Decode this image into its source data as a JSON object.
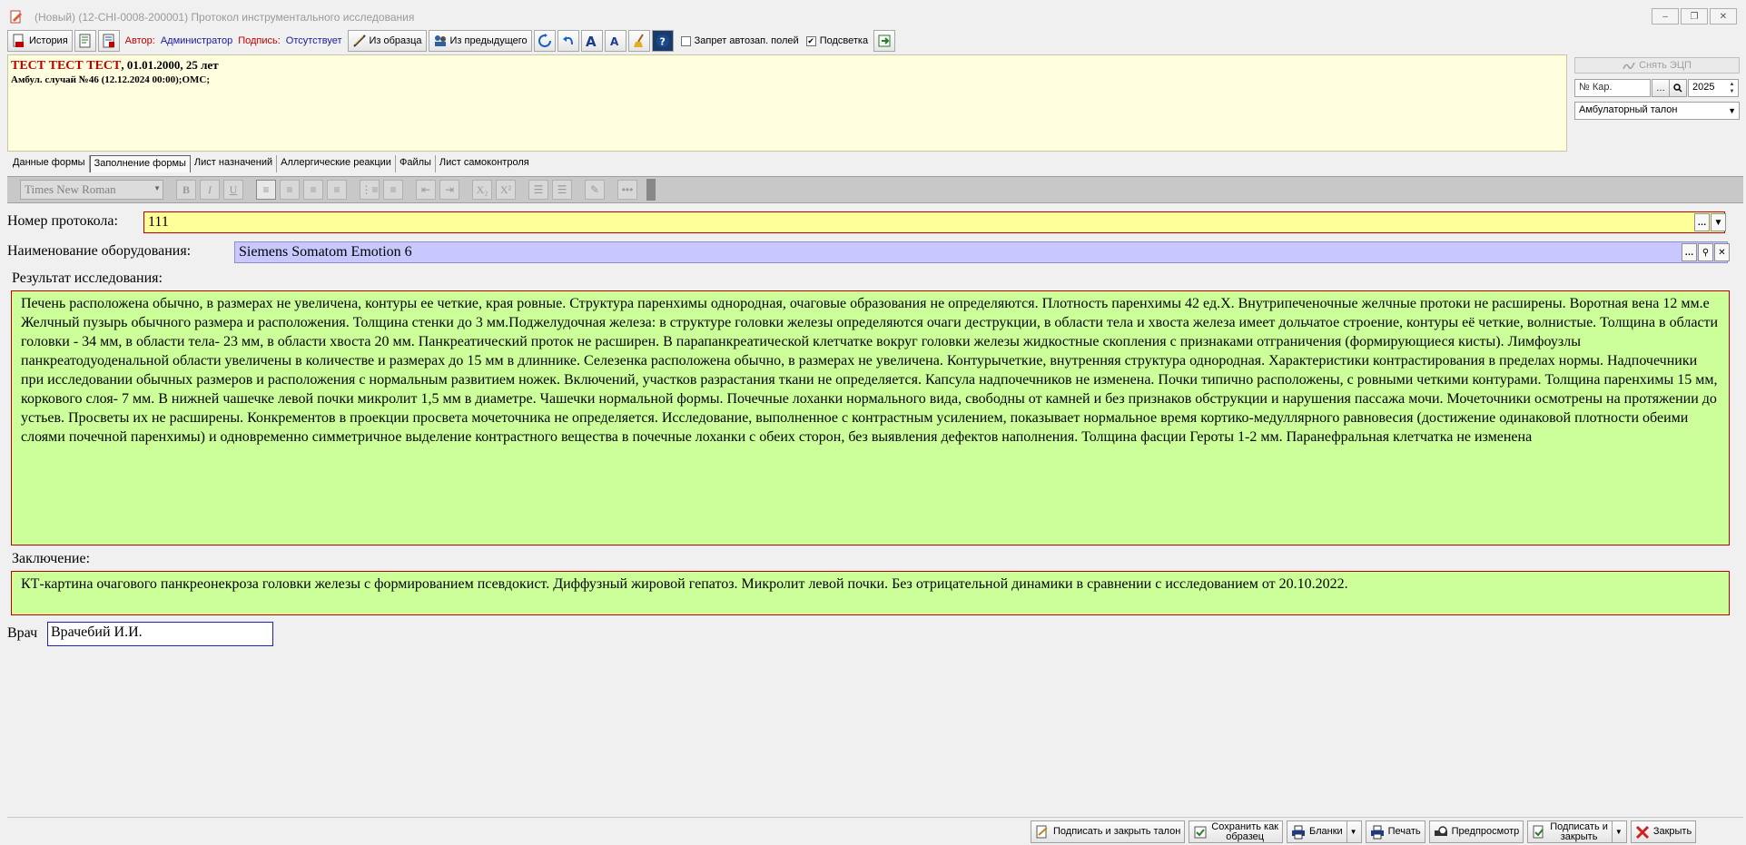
{
  "window": {
    "title": "(Новый) (12-CHI-0008-200001) Протокол инструментального исследования"
  },
  "toolbar": {
    "history_label": "История",
    "author_label": "Автор:",
    "author_value": "Администратор",
    "signature_label": "Подпись:",
    "signature_value": "Отсутствует",
    "from_template_label": "Из образца",
    "from_previous_label": "Из предыдущего",
    "autofill_ban_label": "Запрет автозап. полей",
    "autofill_ban_checked": false,
    "highlight_label": "Подсветка",
    "highlight_checked": true,
    "highlight_mark": "✔"
  },
  "patient": {
    "name": "ТЕСТ ТЕСТ ТЕСТ",
    "details": ", 01.01.2000, 25 лет",
    "case": "Амбул. случай №46 (12.12.2024 00:00);ОМС;"
  },
  "right_panel": {
    "unsign_label": "Снять ЭЦП",
    "card_placeholder": "№ Кар.",
    "year": "2025",
    "talon_type": "Амбулаторный талон"
  },
  "tabs": [
    {
      "label": "Данные формы",
      "active": false
    },
    {
      "label": "Заполнение формы",
      "active": true
    },
    {
      "label": "Лист назначений",
      "active": false
    },
    {
      "label": "Аллергические реакции",
      "active": false
    },
    {
      "label": "Файлы",
      "active": false
    },
    {
      "label": "Лист самоконтроля",
      "active": false
    }
  ],
  "format_toolbar": {
    "font": "Times New Roman"
  },
  "form": {
    "protocol_label": "Номер протокола:",
    "protocol_value": "111",
    "equipment_label": "Наименование оборудования:",
    "equipment_value": "Siemens Somatom Emotion 6",
    "result_label": "Результат исследования:",
    "result_text": "Печень расположена обычно, в размерах не увеличена, контуры ее четкие, края ровные. Структура паренхимы однородная, очаговые образования не определяются. Плотность паренхимы 42 ед.Х. Внутрипеченочные желчные протоки не расширены. Воротная вена 12 мм.е Желчный пузырь обычного размера и расположения. Толщина стенки до 3 мм.Поджелудочная железа: в структуре головки железы определяются очаги деструкции, в области тела и хвоста железа имеет дольчатое строение, контуры её четкие, волнистые. Толщина в области головки - 34 мм, в области тела- 23 мм, в области хвоста 20 мм. Панкреатический проток не расширен. В парапанкреатической клетчатке вокруг головки железы жидкостные скопления с признаками отграничения (формирующиеся кисты). Лимфоузлы панкреатодуоденальной области увеличены в количестве и размерах до 15 мм в длиннике. Селезенка расположена обычно, в размерах не увеличена. Контурычеткие, внутренняя структура однородная. Характеристики контрастирования в пределах нормы.  Надпочечники при исследовании обычных размеров и расположения с нормальным развитием ножек. Включений, участков разрастания ткани не определяется. Капсула надпочечников не изменена. Почки типично расположены, с ровными четкими контурами. Толщина паренхимы 15 мм, коркового слоя- 7 мм. В нижней чашечке левой почки микролит 1,5 мм в диаметре. Чашечки нормальной формы. Почечные лоханки нормального вида, свободны от камней и без признаков обструкции и нарушения пассажа мочи. Мочеточники осмотрены на протяжении до устьев. Просветы их не расширены. Конкрементов в проекции просвета мочеточника не определяется. Исследование, выполненное с контрастным усилением, показывает нормальное время кортико-медуллярного равновесия (достижение одинаковой плотности обеими слоями почечной паренхимы) и одновременно симметричное выделение контрастного вещества в почечные лоханки с обеих сторон, без выявления дефектов наполнения. Толщина фасции Героты 1-2 мм. Паранефральная клетчатка не изменена",
    "conclusion_label": "Заключение:",
    "conclusion_text": "КТ-картина очагового панкреонекроза головки железы с формированием псевдокист. Диффузный жировой гепатоз. Микролит левой почки. Без отрицательной динамики в сравнении с исследованием от 20.10.2022.",
    "doctor_label": "Врач",
    "doctor_value": "Врачебий И.И."
  },
  "bottom_buttons": {
    "sign_close_talon": "Подписать и закрыть талон",
    "save_template_l1": "Сохранить как",
    "save_template_l2": "образец",
    "forms": "Бланки",
    "print": "Печать",
    "preview": "Предпросмотр",
    "sign_close_l1": "Подписать и",
    "sign_close_l2": "закрыть",
    "close": "Закрыть"
  },
  "colors": {
    "required_field_bg": "#ffff99",
    "lookup_field_bg": "#c8c8ff",
    "text_area_bg": "#ccff99",
    "error_border": "#c00000",
    "patient_name": "#c00000"
  }
}
